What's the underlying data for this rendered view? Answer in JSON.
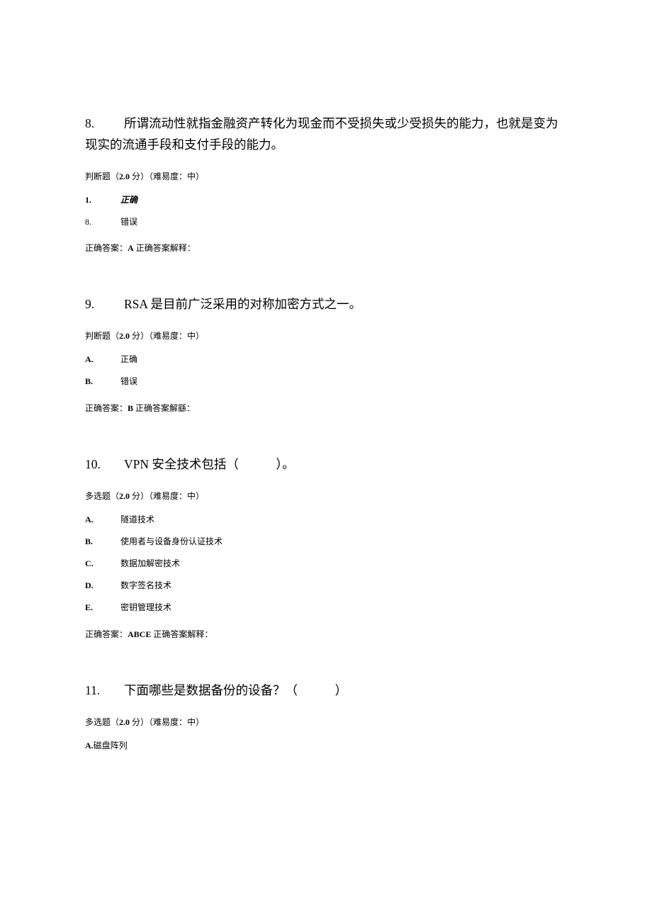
{
  "questions": [
    {
      "number": "8.",
      "title": "所谓流动性就指金融资产转化为现金而不受损失或少受损失的能力，也就是变为现实的流通手段和支付手段的能力。",
      "meta_prefix": "判断题（",
      "meta_points": "2.0",
      "meta_suffix": " 分）（难易度：中）",
      "options": [
        {
          "marker": "1.",
          "text": "正确",
          "bold": true
        },
        {
          "marker": "8.",
          "text": "错误",
          "bold": false
        }
      ],
      "answer_prefix": "正确答案：",
      "answer_key": "A",
      "answer_explain": " 正确答案解释：",
      "marker_bold": true
    },
    {
      "number": "9.",
      "title": "RSA 是目前广泛采用的对称加密方式之一。",
      "meta_prefix": "判断题（",
      "meta_points": "2.0",
      "meta_suffix": " 分）（难易度：中）",
      "options": [
        {
          "marker": "A.",
          "text": "正确",
          "bold": false
        },
        {
          "marker": "B.",
          "text": "错误",
          "bold": false
        }
      ],
      "answer_prefix": "正确答案：",
      "answer_key": "B",
      "answer_explain": " 正确答案解繇：",
      "marker_bold": true
    },
    {
      "number": "10.",
      "title": "VPN 安全技术包括（　　　）。",
      "meta_prefix": "多选题（",
      "meta_points": "2.0",
      "meta_suffix": " 分）（难易度：中）",
      "options": [
        {
          "marker": "A.",
          "text": "隧道技术",
          "bold": false
        },
        {
          "marker": "B.",
          "text": "使用者与设备身份认证技术",
          "bold": false
        },
        {
          "marker": "C.",
          "text": "数据加解密技术",
          "bold": false
        },
        {
          "marker": "D.",
          "text": "数字签名技术",
          "bold": false
        },
        {
          "marker": "E.",
          "text": "密钥管理技术",
          "bold": false
        }
      ],
      "answer_prefix": "正确答案：",
      "answer_key": "ABCE",
      "answer_explain": " 正确答案解释：",
      "marker_bold": true
    },
    {
      "number": "11.",
      "title": "下面哪些是数据备份的设备？（　　　）",
      "meta_prefix": "多选题（",
      "meta_points": "2.0",
      "meta_suffix": " 分）（难易度：中）",
      "inline_options": [
        {
          "marker": "A.",
          "text": "磁盘阵列"
        }
      ],
      "marker_bold": true
    }
  ]
}
